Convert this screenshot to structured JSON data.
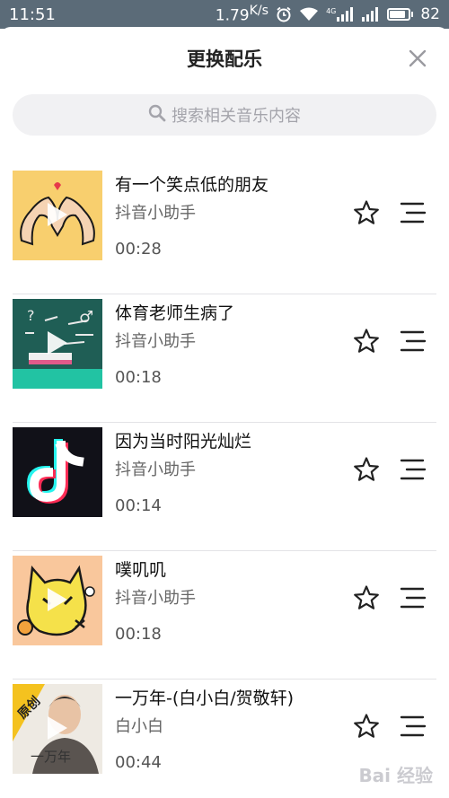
{
  "status_bar": {
    "time": "11:51",
    "speed": "1.79",
    "speed_unit": "K/s",
    "network": "4G",
    "battery": "82"
  },
  "header": {
    "title": "更换配乐"
  },
  "search": {
    "placeholder": "搜索相关音乐内容"
  },
  "songs": [
    {
      "name": "有一个笑点低的朋友",
      "author": "抖音小助手",
      "duration": "00:28",
      "cover_icon": "heart-hands-icon"
    },
    {
      "name": "体育老师生病了",
      "author": "抖音小助手",
      "duration": "00:18",
      "cover_icon": "chalkboard-icon"
    },
    {
      "name": "因为当时阳光灿烂",
      "author": "抖音小助手",
      "duration": "00:14",
      "cover_icon": "tiktok-logo-icon"
    },
    {
      "name": "噗叽叽",
      "author": "抖音小助手",
      "duration": "00:18",
      "cover_icon": "yellow-cat-icon"
    },
    {
      "name": "一万年-(白小白/贺敬轩)",
      "author": "白小白",
      "duration": "00:44",
      "cover_icon": "singer-photo",
      "badge": "原创",
      "cover_text": "一万年"
    }
  ],
  "watermark": "Bai 经验",
  "colors": {
    "status_bar": "#5b6b78",
    "search_bg": "#f1f1f3",
    "text_primary": "#111111",
    "text_secondary": "#666666"
  }
}
